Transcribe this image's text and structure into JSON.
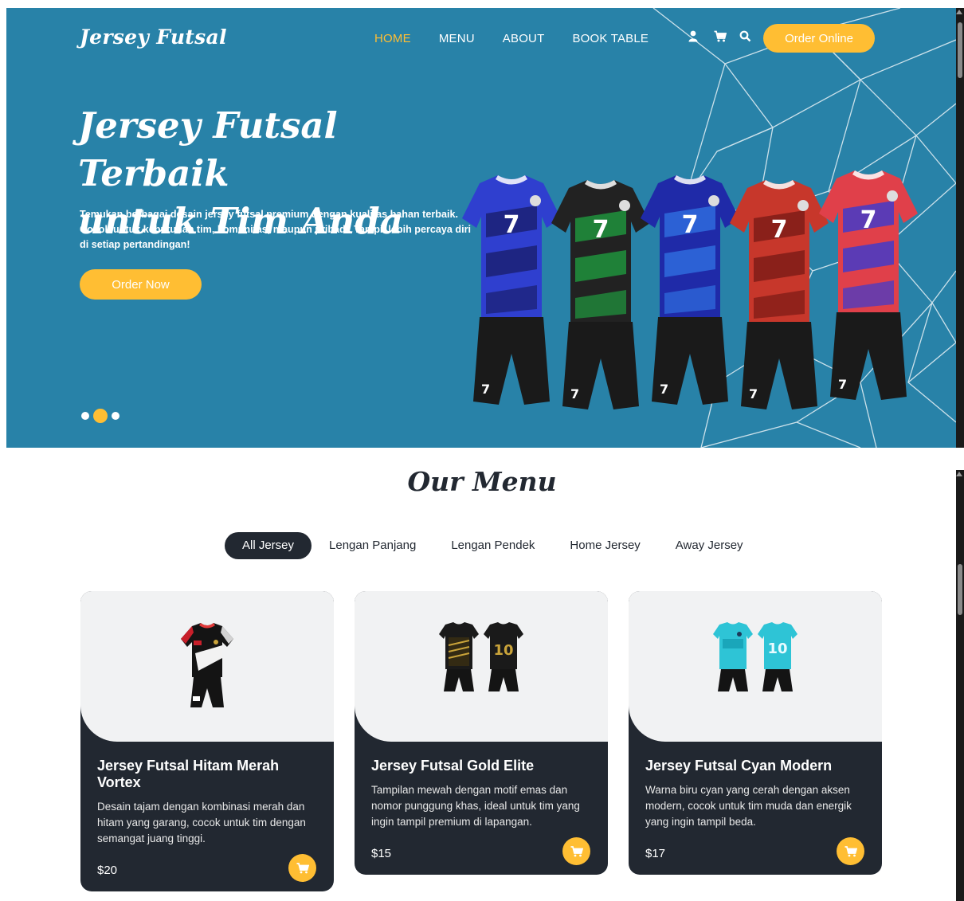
{
  "nav": {
    "logo": "Jersey Futsal",
    "links": [
      {
        "label": "HOME",
        "active": true
      },
      {
        "label": "MENU",
        "active": false
      },
      {
        "label": "ABOUT",
        "active": false
      },
      {
        "label": "BOOK TABLE",
        "active": false
      }
    ],
    "icons": [
      "user-icon",
      "cart-icon",
      "search-icon"
    ],
    "order_online_label": "Order Online"
  },
  "hero": {
    "title_line1": "Jersey Futsal Terbaik",
    "title_line2": "untuk Tim Anda",
    "description": "Temukan berbagai desain jersey futsal premium dengan kualitas bahan terbaik. Cocok untuk kebutuhan tim, komunitas, maupun pribadi. Tampil lebih percaya diri di setiap pertandingan!",
    "order_now_label": "Order Now",
    "jersey_number": "7",
    "slides_total": 3,
    "active_slide": 2
  },
  "menu": {
    "title": "Our Menu",
    "filters": [
      "All Jersey",
      "Lengan Panjang",
      "Lengan Pendek",
      "Home Jersey",
      "Away Jersey"
    ],
    "active_filter": "All Jersey",
    "items": [
      {
        "name": "Jersey Futsal Hitam Merah Vortex",
        "description": "Desain tajam dengan kombinasi merah dan hitam yang garang, cocok untuk tim dengan semangat juang tinggi.",
        "price": "$20"
      },
      {
        "name": "Jersey Futsal Gold Elite",
        "description": "Tampilan mewah dengan motif emas dan nomor punggung khas, ideal untuk tim yang ingin tampil premium di lapangan.",
        "price": "$15"
      },
      {
        "name": "Jersey Futsal Cyan Modern",
        "description": "Warna biru cyan yang cerah dengan aksen modern, cocok untuk tim muda dan energik yang ingin tampil beda.",
        "price": "$17"
      }
    ]
  },
  "colors": {
    "hero_bg": "#2882a8",
    "accent": "#ffbe33",
    "dark": "#222831",
    "card_image_bg": "#f1f2f3"
  }
}
